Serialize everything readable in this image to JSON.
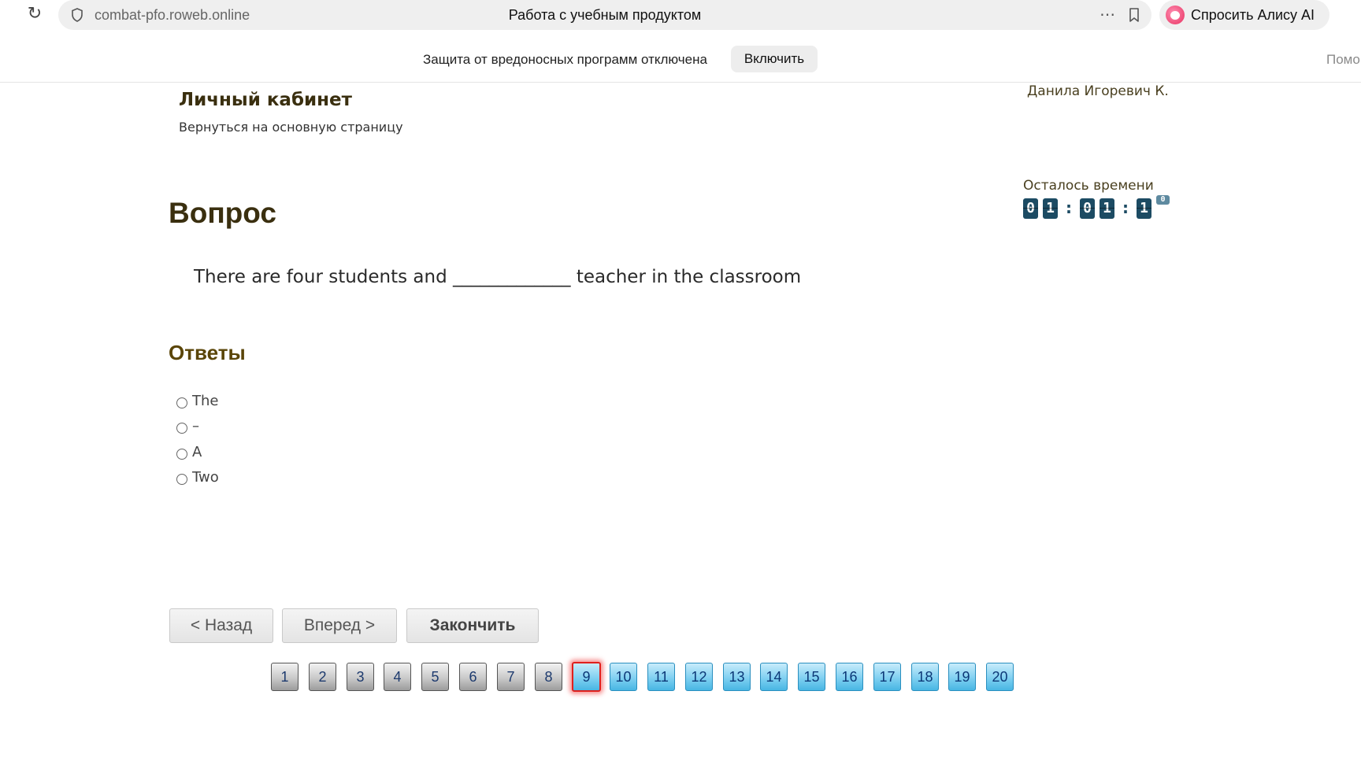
{
  "browser": {
    "url": "combat-pfo.roweb.online",
    "page_title": "Работа с учебным продуктом",
    "more_icon": "⋯",
    "alice_label": "Спросить Алису AI"
  },
  "warning_bar": {
    "message": "Защита от вредоносных программ отключена",
    "enable_label": "Включить",
    "help_label": "Помо"
  },
  "header": {
    "title": "Личный кабинет",
    "back_link": "Вернуться на основную страницу",
    "user_name": "Данила Игоревич К."
  },
  "timer": {
    "label": "Осталось времени",
    "hours": [
      "0",
      "1"
    ],
    "minutes": [
      "0",
      "1"
    ],
    "seconds": [
      "1",
      "0"
    ]
  },
  "question": {
    "heading": "Вопрос",
    "text": "There are four students and _____________ teacher in the classroom"
  },
  "answers": {
    "heading": "Ответы",
    "options": [
      "The",
      "–",
      "A",
      "Two"
    ]
  },
  "navigation": {
    "back_label": "< Назад",
    "next_label": "Вперед >",
    "finish_label": "Закончить"
  },
  "pager": {
    "pages": [
      "1",
      "2",
      "3",
      "4",
      "5",
      "6",
      "7",
      "8",
      "9",
      "10",
      "11",
      "12",
      "13",
      "14",
      "15",
      "16",
      "17",
      "18",
      "19",
      "20"
    ],
    "answered_count": 8,
    "current_page": "9"
  }
}
